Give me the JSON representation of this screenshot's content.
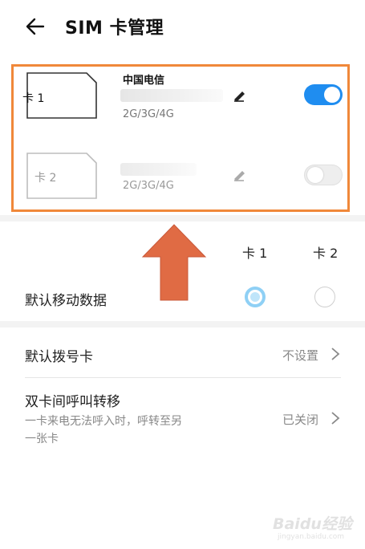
{
  "header": {
    "title": "SIM 卡管理"
  },
  "sim_cards": [
    {
      "card_label": "卡 1",
      "carrier": "中国电信",
      "network": "2G/3G/4G",
      "enabled": true
    },
    {
      "card_label": "卡 2",
      "carrier": "",
      "network": "2G/3G/4G",
      "enabled": false
    }
  ],
  "default_section": {
    "col_card1": "卡 1",
    "col_card2": "卡 2",
    "default_data_label": "默认移动数据",
    "default_data_selected": "card1"
  },
  "settings": {
    "dial_card": {
      "label": "默认拨号卡",
      "value": "不设置"
    },
    "call_forward": {
      "label": "双卡间呼叫转移",
      "sub_line1": "一卡来电无法呼入时，呼转至另",
      "sub_line2": "一张卡",
      "value": "已关闭"
    }
  },
  "colors": {
    "accent": "#1f8df0",
    "highlight_border": "#f0883a",
    "arrow": "#e06b44"
  },
  "watermark": {
    "text": "Baidu经验",
    "url": "jingyan.baidu.com"
  }
}
